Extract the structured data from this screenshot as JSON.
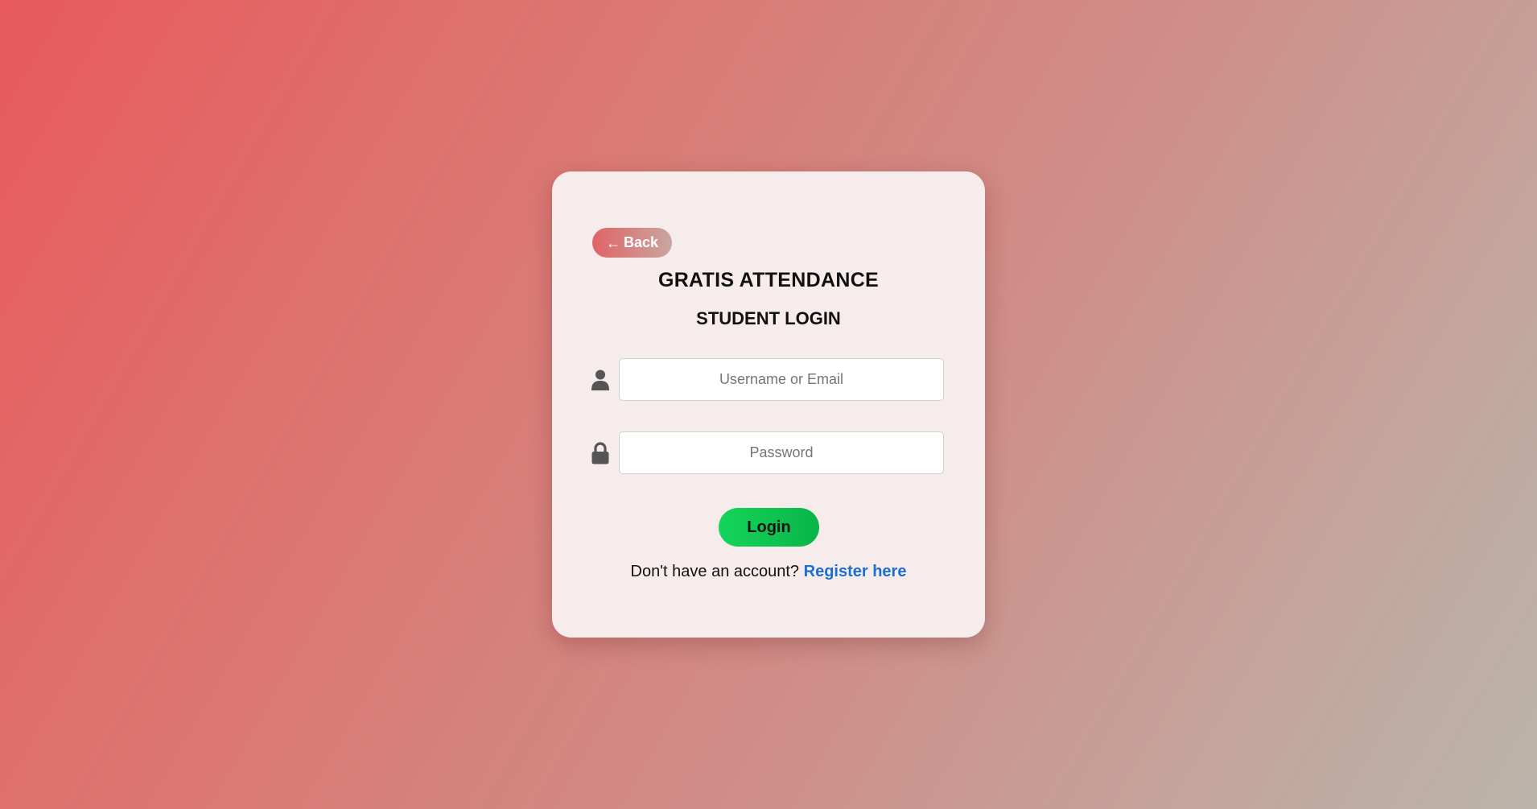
{
  "back_button": {
    "arrow": "←",
    "label": "Back"
  },
  "app_title": "GRATIS ATTENDANCE",
  "page_subtitle": "STUDENT LOGIN",
  "fields": {
    "username": {
      "placeholder": "Username or Email",
      "value": "",
      "icon": "user-icon"
    },
    "password": {
      "placeholder": "Password",
      "value": "",
      "icon": "lock-icon"
    }
  },
  "login_button": {
    "label": "Login"
  },
  "register": {
    "prompt": "Don't have an account?",
    "link_label": "Register here"
  },
  "colors": {
    "background_start": "#e85a5c",
    "background_end": "#bab4aa",
    "card": "#f7ecec",
    "login_button": "#14d45a",
    "link": "#1a6fd0"
  }
}
